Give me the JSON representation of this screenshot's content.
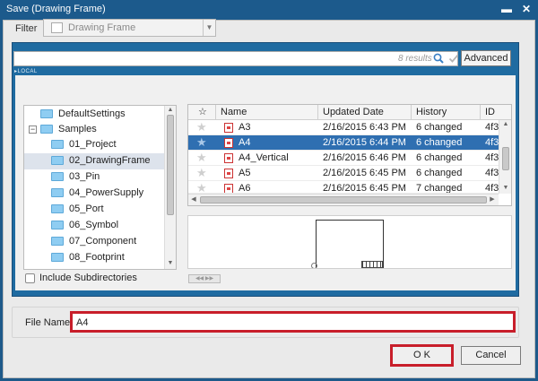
{
  "window": {
    "title": "Save (Drawing Frame)"
  },
  "filter": {
    "label": "Filter",
    "value": "Drawing Frame"
  },
  "search": {
    "value": "",
    "results": "8 results",
    "advanced_label": "Advanced",
    "local_label": "LOCAL"
  },
  "tree": {
    "items": [
      {
        "label": "DefaultSettings",
        "level": 1,
        "selected": false
      },
      {
        "label": "Samples",
        "level": 0,
        "expander": "−",
        "selected": false
      },
      {
        "label": "01_Project",
        "level": 2,
        "selected": false
      },
      {
        "label": "02_DrawingFrame",
        "level": 2,
        "selected": true
      },
      {
        "label": "03_Pin",
        "level": 2,
        "selected": false
      },
      {
        "label": "04_PowerSupply",
        "level": 2,
        "selected": false
      },
      {
        "label": "05_Port",
        "level": 2,
        "selected": false
      },
      {
        "label": "06_Symbol",
        "level": 2,
        "selected": false
      },
      {
        "label": "07_Component",
        "level": 2,
        "selected": false
      },
      {
        "label": "08_Footprint",
        "level": 2,
        "selected": false
      }
    ],
    "include_subdirectories": "Include Subdirectories"
  },
  "grid": {
    "columns": [
      "☆",
      "Name",
      "Updated Date",
      "History",
      "ID"
    ],
    "rows": [
      {
        "name": "A3",
        "date": "2/16/2015 6:43 PM",
        "history": "6 changed",
        "id": "4f3",
        "selected": false
      },
      {
        "name": "A4",
        "date": "2/16/2015 6:44 PM",
        "history": "6 changed",
        "id": "4f3",
        "selected": true
      },
      {
        "name": "A4_Vertical",
        "date": "2/16/2015 6:46 PM",
        "history": "6 changed",
        "id": "4f3",
        "selected": false
      },
      {
        "name": "A5",
        "date": "2/16/2015 6:45 PM",
        "history": "6 changed",
        "id": "4f3",
        "selected": false
      },
      {
        "name": "A6",
        "date": "2/16/2015 6:45 PM",
        "history": "7 changed",
        "id": "4f3",
        "selected": false
      }
    ]
  },
  "filename": {
    "label": "File Name",
    "value": "A4"
  },
  "buttons": {
    "ok": "O K",
    "cancel": "Cancel"
  }
}
